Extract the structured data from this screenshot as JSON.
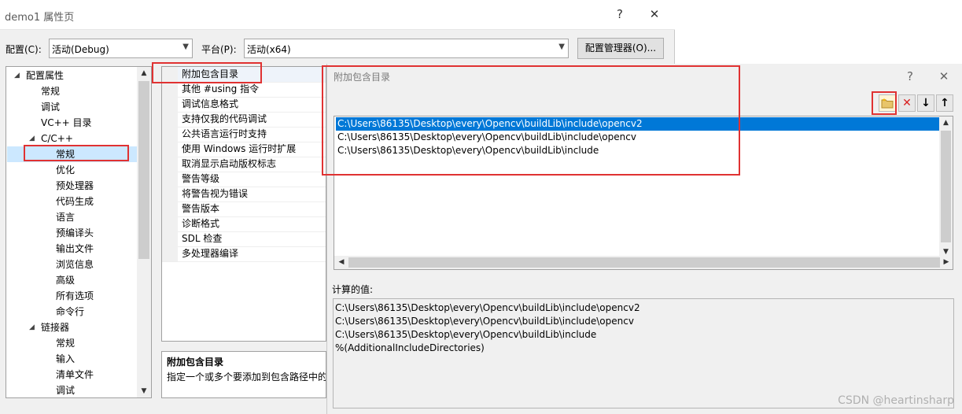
{
  "main_window": {
    "title": "demo1 属性页",
    "help": "?",
    "close": "✕",
    "config_label": "配置(C):",
    "config_value": "活动(Debug)",
    "platform_label": "平台(P):",
    "platform_value": "活动(x64)",
    "config_manager": "配置管理器(O)..."
  },
  "tree": {
    "items": [
      {
        "label": "配置属性"
      },
      {
        "label": "常规"
      },
      {
        "label": "调试"
      },
      {
        "label": "VC++ 目录"
      },
      {
        "label": "C/C++"
      },
      {
        "label": "常规"
      },
      {
        "label": "优化"
      },
      {
        "label": "预处理器"
      },
      {
        "label": "代码生成"
      },
      {
        "label": "语言"
      },
      {
        "label": "预编译头"
      },
      {
        "label": "输出文件"
      },
      {
        "label": "浏览信息"
      },
      {
        "label": "高级"
      },
      {
        "label": "所有选项"
      },
      {
        "label": "命令行"
      },
      {
        "label": "链接器"
      },
      {
        "label": "常规"
      },
      {
        "label": "输入"
      },
      {
        "label": "清单文件"
      },
      {
        "label": "调试"
      }
    ]
  },
  "properties": [
    "附加包含目录",
    "其他 #using 指令",
    "调试信息格式",
    "支持仅我的代码调试",
    "公共语言运行时支持",
    "使用 Windows 运行时扩展",
    "取消显示启动版权标志",
    "警告等级",
    "将警告视为错误",
    "警告版本",
    "诊断格式",
    "SDL 检查",
    "多处理器编译"
  ],
  "description": {
    "title": "附加包含目录",
    "text": "指定一个或多个要添加到包含路径中的"
  },
  "child_dialog": {
    "title": "附加包含目录",
    "help": "?",
    "close": "✕",
    "entries": [
      "C:\\Users\\86135\\Desktop\\every\\Opencv\\buildLib\\include\\opencv2",
      "C:\\Users\\86135\\Desktop\\every\\Opencv\\buildLib\\include\\opencv",
      "C:\\Users\\86135\\Desktop\\every\\Opencv\\buildLib\\include"
    ],
    "calc_label": "计算的值:",
    "calc_values": [
      "C:\\Users\\86135\\Desktop\\every\\Opencv\\buildLib\\include\\opencv2",
      "C:\\Users\\86135\\Desktop\\every\\Opencv\\buildLib\\include\\opencv",
      "C:\\Users\\86135\\Desktop\\every\\Opencv\\buildLib\\include",
      "%(AdditionalIncludeDirectories)"
    ],
    "toolbar_icons": [
      "new-line-icon",
      "delete-icon",
      "move-down-icon",
      "move-up-icon"
    ]
  },
  "watermark": "CSDN @heartinsharp",
  "colors": {
    "selection": "#0078d7",
    "highlight": "#e03232"
  }
}
